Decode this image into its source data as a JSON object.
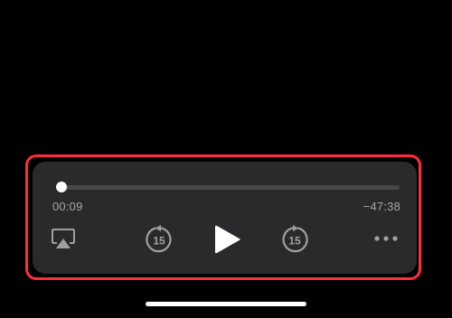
{
  "player": {
    "elapsed_time": "00:09",
    "remaining_time": "−47:38",
    "progress_fraction": 0.01,
    "skip_back_seconds": "15",
    "skip_forward_seconds": "15"
  },
  "colors": {
    "background": "#000000",
    "card": "#2a2a2c",
    "highlight": "#ff2d3d",
    "track": "#47474a",
    "icon": "#a0a0a4",
    "play": "#ffffff"
  },
  "icons": {
    "airplay": "airplay-icon",
    "skip_back": "skip-back-15-icon",
    "play": "play-icon",
    "skip_forward": "skip-forward-15-icon",
    "more": "more-ellipsis-icon"
  }
}
